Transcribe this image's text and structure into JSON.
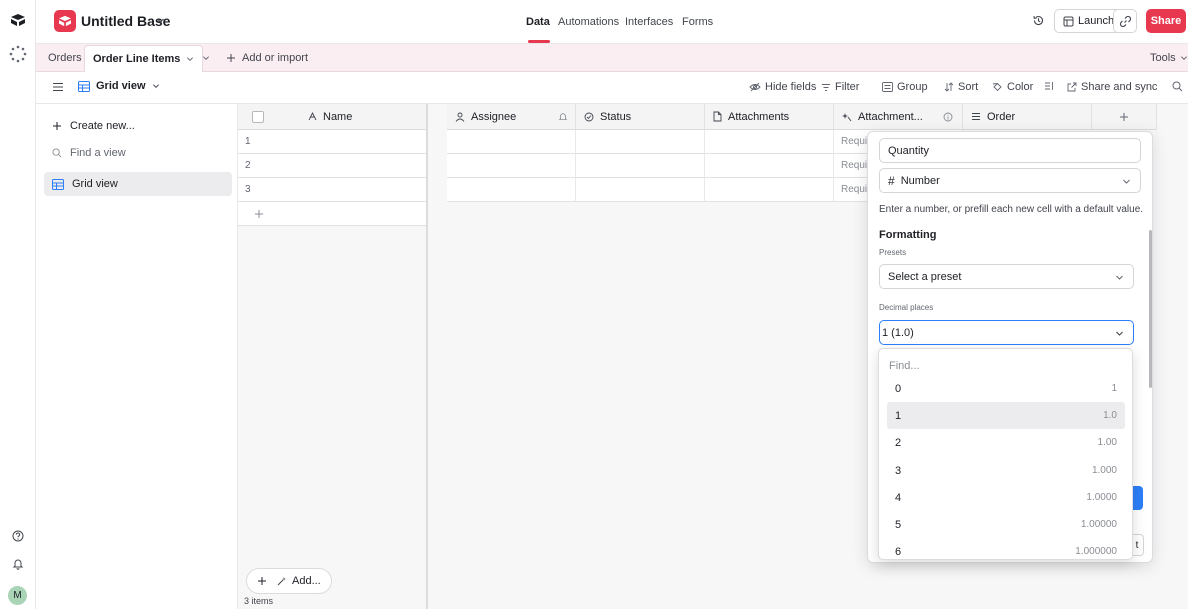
{
  "rail": {
    "icons": [
      "airtable-logo-icon",
      "loading-spinner-icon",
      "help-icon",
      "bell-icon"
    ],
    "avatar_initial": "M"
  },
  "header": {
    "base_title": "Untitled Base",
    "nav": [
      "Data",
      "Automations",
      "Interfaces",
      "Forms"
    ],
    "active_nav": "Data",
    "launch_label": "Launch",
    "share_label": "Share",
    "accent_color": "#e8384f"
  },
  "tabs": {
    "items": [
      "Orders",
      "Order Line Items"
    ],
    "active": "Order Line Items",
    "add_label": "Add or import",
    "tools_label": "Tools"
  },
  "viewbar": {
    "view_name": "Grid view",
    "tools": [
      "Hide fields",
      "Filter",
      "Group",
      "Sort",
      "Color",
      "Share and sync"
    ]
  },
  "sidebar": {
    "create_label": "Create new...",
    "find_placeholder": "Find a view",
    "views": [
      "Grid view"
    ]
  },
  "grid": {
    "columns": [
      "Name",
      "Assignee",
      "Status",
      "Attachments",
      "Attachment...",
      "Order"
    ],
    "rows": [
      {
        "num": "1",
        "attachment_summary": "Require"
      },
      {
        "num": "2",
        "attachment_summary": "Require"
      },
      {
        "num": "3",
        "attachment_summary": "Require"
      }
    ],
    "add_label": "Add...",
    "record_count": "3 items"
  },
  "field_panel": {
    "field_name": "Quantity",
    "field_type": "Number",
    "description": "Enter a number, or prefill each new cell with a default value.",
    "formatting_heading": "Formatting",
    "presets_label": "Presets",
    "preset_value": "Select a preset",
    "decimal_label": "Decimal places",
    "decimal_value": "1 (1.0)",
    "cancel_peek": "t",
    "focus_color": "#2d7ff9"
  },
  "decimal_dropdown": {
    "search_placeholder": "Find...",
    "options": [
      {
        "label": "0",
        "example": "1"
      },
      {
        "label": "1",
        "example": "1.0"
      },
      {
        "label": "2",
        "example": "1.00"
      },
      {
        "label": "3",
        "example": "1.000"
      },
      {
        "label": "4",
        "example": "1.0000"
      },
      {
        "label": "5",
        "example": "1.00000"
      },
      {
        "label": "6",
        "example": "1.000000"
      }
    ],
    "selected": "1"
  }
}
